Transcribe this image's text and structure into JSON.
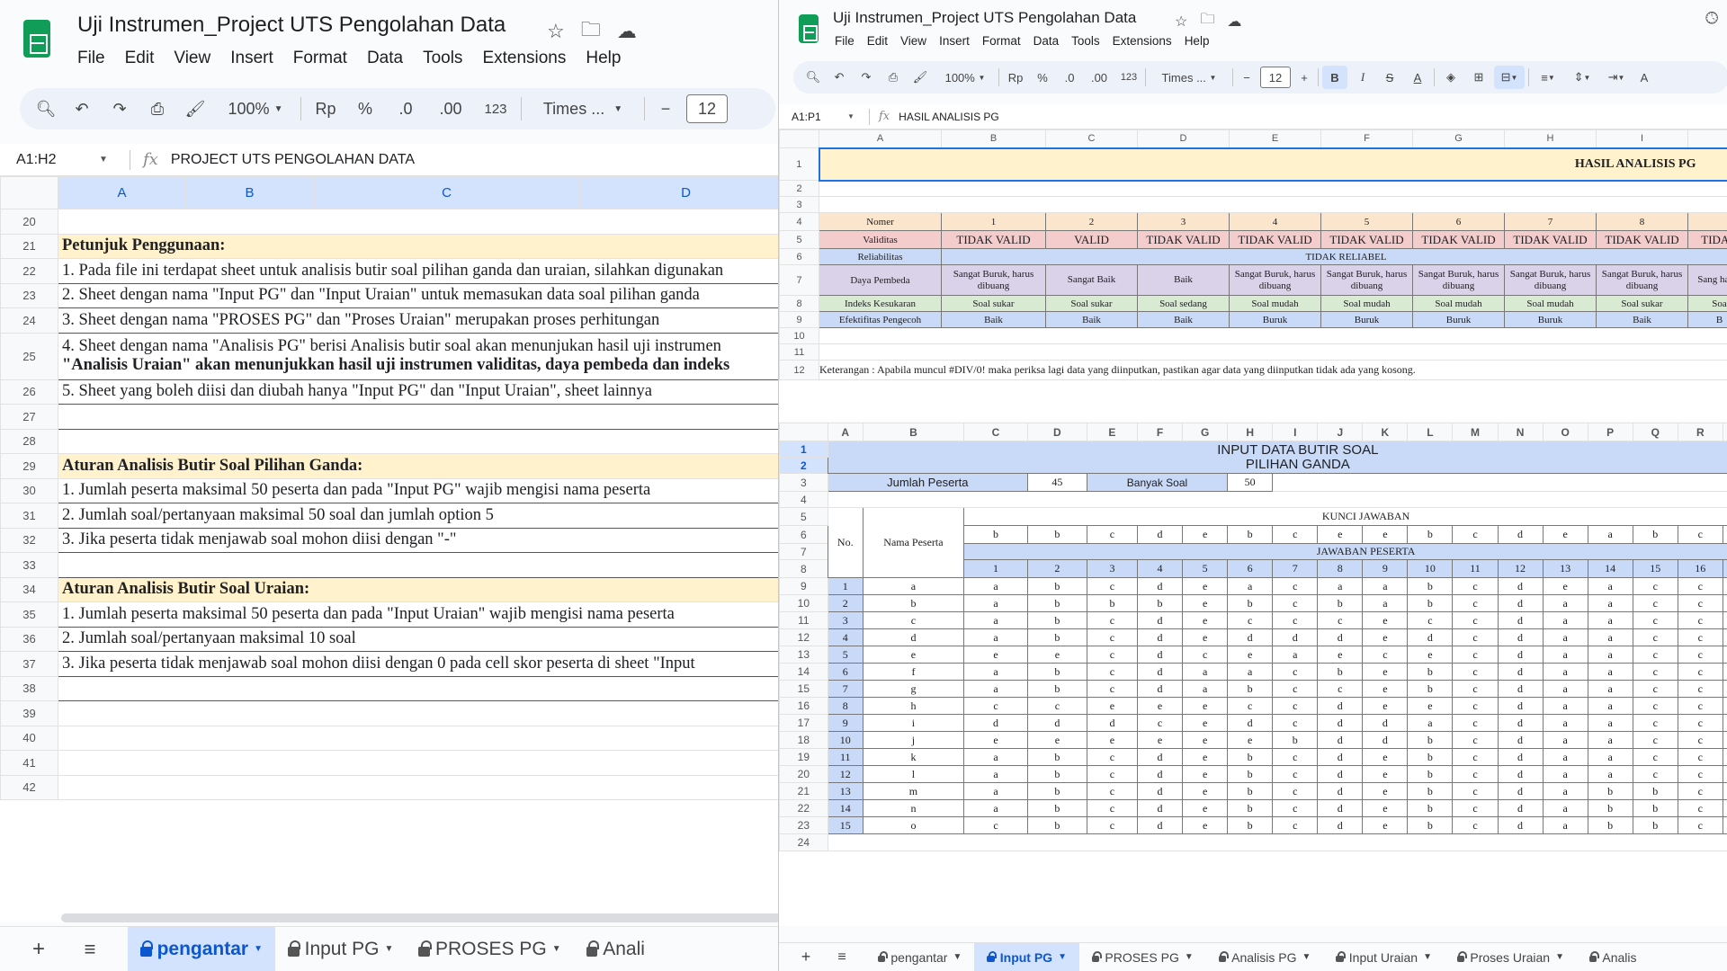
{
  "left": {
    "doc_title": "Uji Instrumen_Project UTS Pengolahan Data",
    "menu": [
      "File",
      "Edit",
      "View",
      "Insert",
      "Format",
      "Data",
      "Tools",
      "Extensions",
      "Help"
    ],
    "toolbar": {
      "zoom": "100%",
      "currency": "Rp",
      "percent": "%",
      "dec_dec": ".0",
      "inc_dec": ".00",
      "number_format": "123",
      "font": "Times ...",
      "font_size": "12"
    },
    "name_box": "A1:H2",
    "formula": "PROJECT UTS PENGOLAHAN DATA",
    "columns": [
      "A",
      "B",
      "C",
      "D"
    ],
    "rows": [
      {
        "n": "20",
        "text": "",
        "type": "empty"
      },
      {
        "n": "21",
        "text": "Petunjuk Penggunaan:",
        "type": "header"
      },
      {
        "n": "22",
        "text": "1. Pada file ini terdapat sheet untuk analisis butir soal pilihan ganda dan uraian, silahkan digunakan",
        "type": "item"
      },
      {
        "n": "23",
        "text": "2. Sheet dengan nama \"Input PG\" dan \"Input Uraian\" untuk memasukan data soal pilihan ganda",
        "type": "item"
      },
      {
        "n": "24",
        "text": "3. Sheet dengan nama \"PROSES PG\" dan \"Proses Uraian\" merupakan proses perhitungan",
        "type": "item"
      },
      {
        "n": "25",
        "text": "4. Sheet dengan nama \"Analisis PG\" berisi Analisis butir soal akan menunjukan hasil uji instrumen",
        "text2": "\"Analisis Uraian\" akan menunjukkan hasil uji instrumen validitas, daya pembeda dan indeks",
        "type": "item2"
      },
      {
        "n": "26",
        "text": "5. Sheet yang boleh diisi dan diubah hanya \"Input PG\" dan \"Input Uraian\", sheet lainnya",
        "type": "item"
      },
      {
        "n": "27",
        "text": "",
        "type": "empty"
      },
      {
        "n": "28",
        "text": "",
        "type": "empty"
      },
      {
        "n": "29",
        "text": "Aturan Analisis Butir Soal Pilihan Ganda:",
        "type": "header"
      },
      {
        "n": "30",
        "text": "1. Jumlah peserta maksimal 50 peserta dan pada \"Input PG\" wajib mengisi nama peserta",
        "type": "item"
      },
      {
        "n": "31",
        "text": "2. Jumlah soal/pertanyaan maksimal 50 soal dan jumlah option  5",
        "type": "item"
      },
      {
        "n": "32",
        "text": "3. Jika peserta tidak menjawab soal mohon diisi dengan \"-\"",
        "type": "item"
      },
      {
        "n": "33",
        "text": "",
        "type": "empty"
      },
      {
        "n": "34",
        "text": "Aturan Analisis Butir Soal Uraian:",
        "type": "header"
      },
      {
        "n": "35",
        "text": "1. Jumlah peserta maksimal 50 peserta dan pada \"Input Uraian\" wajib mengisi nama peserta",
        "type": "item"
      },
      {
        "n": "36",
        "text": "2. Jumlah soal/pertanyaan maksimal 10 soal",
        "type": "item"
      },
      {
        "n": "37",
        "text": "3. Jika peserta tidak menjawab soal mohon diisi dengan 0 pada cell skor peserta di sheet \"Input",
        "type": "item"
      },
      {
        "n": "38",
        "text": "",
        "type": "empty"
      },
      {
        "n": "39",
        "text": "",
        "type": "empty"
      },
      {
        "n": "40",
        "text": "",
        "type": "empty"
      },
      {
        "n": "41",
        "text": "",
        "type": "empty"
      },
      {
        "n": "42",
        "text": "",
        "type": "empty"
      }
    ],
    "tabs": [
      "pengantar",
      "Input PG",
      "PROSES PG",
      "Anali"
    ]
  },
  "right": {
    "doc_title": "Uji Instrumen_Project UTS Pengolahan Data",
    "menu": [
      "File",
      "Edit",
      "View",
      "Insert",
      "Format",
      "Data",
      "Tools",
      "Extensions",
      "Help"
    ],
    "toolbar": {
      "zoom": "100%",
      "currency": "Rp",
      "percent": "%",
      "dec_dec": ".0",
      "inc_dec": ".00",
      "number_format": "123",
      "font": "Times ...",
      "font_size": "12"
    },
    "name_box": "A1:P1",
    "formula": "HASIL ANALISIS PG",
    "analysis": {
      "columns": [
        "A",
        "B",
        "C",
        "D",
        "E",
        "F",
        "G",
        "H",
        "I"
      ],
      "title": "HASIL ANALISIS PG",
      "labels": {
        "nomor": "Nomer",
        "validitas": "Validitas",
        "reliabilitas": "Reliabilitas",
        "daya": "Daya Pembeda",
        "indeks": "Indeks Kesukaran",
        "efek": "Efektifitas Pengecoh"
      },
      "nomor": [
        "1",
        "2",
        "3",
        "4",
        "5",
        "6",
        "7",
        "8"
      ],
      "validitas": [
        "TIDAK VALID",
        "VALID",
        "TIDAK VALID",
        "TIDAK VALID",
        "TIDAK VALID",
        "TIDAK VALID",
        "TIDAK VALID",
        "TIDAK VALID",
        "TIDAK"
      ],
      "reliabilitas": "TIDAK RELIABEL",
      "daya": [
        "Sangat Buruk, harus dibuang",
        "Sangat Baik",
        "Baik",
        "Sangat Buruk, harus dibuang",
        "Sangat Buruk, harus dibuang",
        "Sangat Buruk, harus dibuang",
        "Sangat Buruk, harus dibuang",
        "Sangat Buruk, harus dibuang",
        "Sang harus"
      ],
      "indeks": [
        "Soal sukar",
        "Soal sukar",
        "Soal sedang",
        "Soal mudah",
        "Soal mudah",
        "Soal mudah",
        "Soal mudah",
        "Soal sukar",
        "Soa"
      ],
      "efek": [
        "Baik",
        "Baik",
        "Baik",
        "Buruk",
        "Buruk",
        "Buruk",
        "Buruk",
        "Baik",
        "B"
      ],
      "keterangan": "Keterangan : Apabila muncul #DIV/0! maka periksa lagi data yang diinputkan, pastikan agar data yang diinputkan tidak ada yang kosong."
    },
    "input": {
      "columns": [
        "A",
        "B",
        "C",
        "D",
        "E",
        "F",
        "G",
        "H",
        "I",
        "J",
        "K",
        "L",
        "M",
        "N",
        "O",
        "P",
        "Q",
        "R",
        "S"
      ],
      "title1": "INPUT DATA BUTIR SOAL",
      "title2": "PILIHAN GANDA",
      "jumlah_label": "Jumlah Peserta",
      "jumlah_value": "45",
      "banyak_label": "Banyak Soal",
      "banyak_value": "50",
      "kunci_label": "KUNCI JAWABAN",
      "no_label": "No.",
      "nama_label": "Nama Peserta",
      "kunci": [
        "b",
        "b",
        "c",
        "d",
        "e",
        "b",
        "c",
        "e",
        "e",
        "b",
        "c",
        "d",
        "e",
        "a",
        "b",
        "c",
        "d"
      ],
      "jawaban_label": "JAWABAN PESERTA",
      "qnums": [
        "1",
        "2",
        "3",
        "4",
        "5",
        "6",
        "7",
        "8",
        "9",
        "10",
        "11",
        "12",
        "13",
        "14",
        "15",
        "16",
        "17"
      ],
      "students": [
        {
          "no": "1",
          "nama": "a",
          "ans": [
            "a",
            "b",
            "c",
            "d",
            "e",
            "a",
            "c",
            "a",
            "a",
            "b",
            "c",
            "d",
            "e",
            "a",
            "c",
            "c",
            "d"
          ]
        },
        {
          "no": "2",
          "nama": "b",
          "ans": [
            "a",
            "b",
            "b",
            "b",
            "e",
            "b",
            "c",
            "b",
            "a",
            "b",
            "c",
            "d",
            "a",
            "a",
            "c",
            "c",
            "d"
          ]
        },
        {
          "no": "3",
          "nama": "c",
          "ans": [
            "a",
            "b",
            "c",
            "d",
            "e",
            "c",
            "c",
            "c",
            "e",
            "c",
            "c",
            "d",
            "a",
            "a",
            "c",
            "c",
            "d"
          ]
        },
        {
          "no": "4",
          "nama": "d",
          "ans": [
            "a",
            "b",
            "c",
            "d",
            "e",
            "d",
            "d",
            "d",
            "e",
            "d",
            "c",
            "d",
            "a",
            "a",
            "c",
            "c",
            "d"
          ]
        },
        {
          "no": "5",
          "nama": "e",
          "ans": [
            "e",
            "e",
            "c",
            "d",
            "c",
            "e",
            "a",
            "e",
            "c",
            "e",
            "c",
            "d",
            "a",
            "a",
            "c",
            "c",
            "d"
          ]
        },
        {
          "no": "6",
          "nama": "f",
          "ans": [
            "a",
            "b",
            "c",
            "d",
            "a",
            "a",
            "c",
            "b",
            "e",
            "b",
            "c",
            "d",
            "a",
            "a",
            "c",
            "c",
            "d"
          ]
        },
        {
          "no": "7",
          "nama": "g",
          "ans": [
            "a",
            "b",
            "c",
            "d",
            "a",
            "b",
            "c",
            "c",
            "e",
            "b",
            "c",
            "d",
            "a",
            "a",
            "c",
            "c",
            "d"
          ]
        },
        {
          "no": "8",
          "nama": "h",
          "ans": [
            "c",
            "c",
            "e",
            "e",
            "e",
            "c",
            "c",
            "d",
            "e",
            "e",
            "c",
            "d",
            "a",
            "a",
            "c",
            "c",
            "d"
          ]
        },
        {
          "no": "9",
          "nama": "i",
          "ans": [
            "d",
            "d",
            "d",
            "c",
            "e",
            "d",
            "c",
            "d",
            "d",
            "a",
            "c",
            "d",
            "a",
            "a",
            "c",
            "c",
            "d"
          ]
        },
        {
          "no": "10",
          "nama": "j",
          "ans": [
            "e",
            "e",
            "e",
            "e",
            "e",
            "e",
            "b",
            "d",
            "d",
            "b",
            "c",
            "d",
            "a",
            "a",
            "c",
            "c",
            "d"
          ]
        },
        {
          "no": "11",
          "nama": "k",
          "ans": [
            "a",
            "b",
            "c",
            "d",
            "e",
            "b",
            "c",
            "d",
            "e",
            "b",
            "c",
            "d",
            "a",
            "a",
            "c",
            "c",
            "d"
          ]
        },
        {
          "no": "12",
          "nama": "l",
          "ans": [
            "a",
            "b",
            "c",
            "d",
            "e",
            "b",
            "c",
            "d",
            "e",
            "b",
            "c",
            "d",
            "a",
            "a",
            "c",
            "c",
            "a"
          ]
        },
        {
          "no": "13",
          "nama": "m",
          "ans": [
            "a",
            "b",
            "c",
            "d",
            "e",
            "b",
            "c",
            "d",
            "e",
            "b",
            "c",
            "d",
            "a",
            "b",
            "b",
            "c",
            "a"
          ]
        },
        {
          "no": "14",
          "nama": "n",
          "ans": [
            "a",
            "b",
            "c",
            "d",
            "e",
            "b",
            "c",
            "d",
            "e",
            "b",
            "c",
            "d",
            "a",
            "b",
            "b",
            "c",
            "a"
          ]
        },
        {
          "no": "15",
          "nama": "o",
          "ans": [
            "c",
            "b",
            "c",
            "d",
            "e",
            "b",
            "c",
            "d",
            "e",
            "b",
            "c",
            "d",
            "a",
            "b",
            "b",
            "c",
            "a"
          ]
        }
      ],
      "row_nums": [
        "1",
        "2",
        "3",
        "4",
        "5",
        "6",
        "7",
        "8",
        "9",
        "10",
        "11",
        "12",
        "13",
        "14",
        "15",
        "16",
        "17",
        "18",
        "19",
        "20",
        "21",
        "22",
        "23",
        "24"
      ]
    },
    "analysis_row_nums": [
      "1",
      "2",
      "3",
      "4",
      "5",
      "6",
      "7",
      "8",
      "9",
      "10",
      "11",
      "12"
    ],
    "tabs": [
      "pengantar",
      "Input PG",
      "PROSES PG",
      "Analisis PG",
      "Input Uraian",
      "Proses Uraian",
      "Analis"
    ]
  },
  "colors": {
    "accent": "#0b57d0",
    "header_fill": "#fff2cc",
    "sheets_green": "#0f9d58"
  }
}
